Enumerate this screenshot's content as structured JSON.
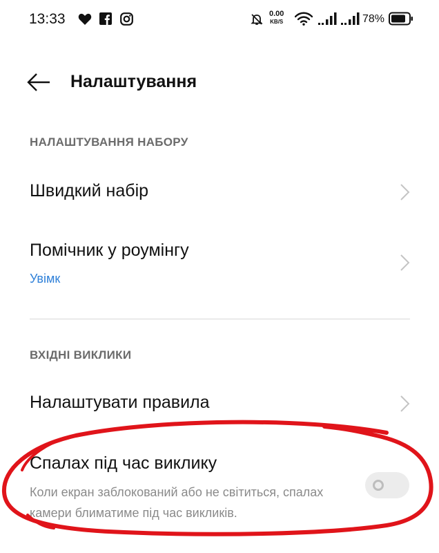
{
  "status_bar": {
    "time": "13:33",
    "net_speed": "0.00",
    "net_unit": "KB/S",
    "battery": "78%",
    "icons": [
      "heart-icon",
      "facebook-icon",
      "instagram-icon",
      "mute-icon",
      "wifi-icon",
      "signal-icon",
      "signal-icon",
      "battery-icon"
    ]
  },
  "header": {
    "title": "Налаштування",
    "back_icon": "arrow-left-icon"
  },
  "sections": [
    {
      "title": "НАЛАШТУВАННЯ НАБОРУ",
      "items": [
        {
          "label": "Швидкий набір"
        },
        {
          "label": "Помічник у роумінгу",
          "value": "Увімк"
        }
      ]
    },
    {
      "title": "ВХІДНІ ВИКЛИКИ",
      "items": [
        {
          "label": "Налаштувати правила"
        },
        {
          "label": "Спалах під час виклику",
          "description": "Коли екран заблокований або не світиться, спалах камери блиматиме під час викликів.",
          "toggle": false
        }
      ]
    }
  ],
  "colors": {
    "accent": "#2f80d8",
    "annotation": "#e0141a"
  }
}
